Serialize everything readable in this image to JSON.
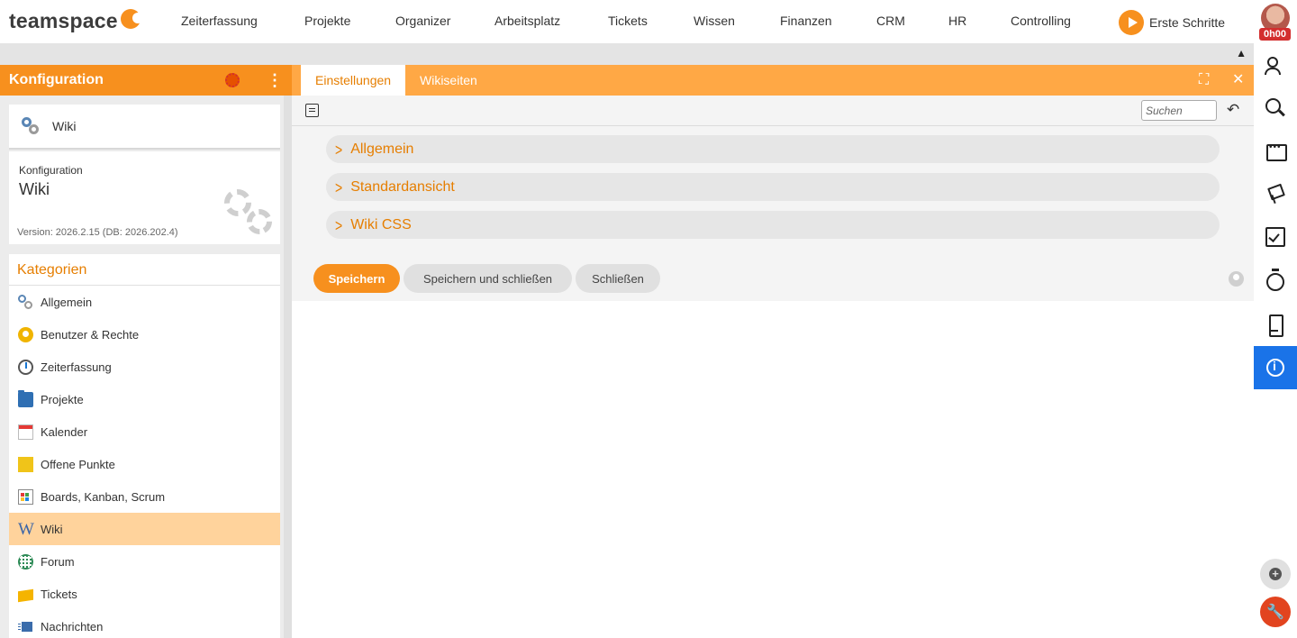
{
  "brand": {
    "name": "teamspace"
  },
  "nav": {
    "items": [
      "Zeiterfassung",
      "Projekte",
      "Organizer",
      "Arbeitsplatz",
      "Tickets",
      "Wissen",
      "Finanzen",
      "CRM",
      "HR",
      "Controlling"
    ],
    "erste_schritte": "Erste Schritte",
    "timer": "0h00"
  },
  "left": {
    "header_title": "Konfiguration",
    "module_card": {
      "label": "Wiki"
    },
    "info_card": {
      "small": "Konfiguration",
      "title": "Wiki",
      "version": "Version: 2026.2.15 (DB: 2026.202.4)"
    },
    "categories": {
      "title": "Kategorien",
      "items": [
        {
          "label": "Allgemein",
          "icon": "gears-icon"
        },
        {
          "label": "Benutzer & Rechte",
          "icon": "users-icon"
        },
        {
          "label": "Zeiterfassung",
          "icon": "stopwatch-icon"
        },
        {
          "label": "Projekte",
          "icon": "folder-icon"
        },
        {
          "label": "Kalender",
          "icon": "calendar-icon"
        },
        {
          "label": "Offene Punkte",
          "icon": "sticky-note-icon"
        },
        {
          "label": "Boards, Kanban, Scrum",
          "icon": "board-icon"
        },
        {
          "label": "Wiki",
          "icon": "wiki-icon",
          "active": true
        },
        {
          "label": "Forum",
          "icon": "globe-icon"
        },
        {
          "label": "Tickets",
          "icon": "ticket-icon"
        },
        {
          "label": "Nachrichten",
          "icon": "messages-icon"
        }
      ]
    }
  },
  "main": {
    "tabs": [
      {
        "label": "Einstellungen",
        "active": true
      },
      {
        "label": "Wikiseiten",
        "active": false
      }
    ],
    "search": {
      "placeholder": "Suchen",
      "value": ""
    },
    "sections": [
      {
        "label": "Allgemein"
      },
      {
        "label": "Standardansicht"
      },
      {
        "label": "Wiki CSS"
      }
    ],
    "buttons": {
      "save": "Speichern",
      "save_close": "Speichern und schließen",
      "close": "Schließen"
    }
  },
  "colors": {
    "accent": "#f7901e",
    "tab_bar": "#ffa845",
    "active_item": "#ffd39c",
    "info_active": "#1a73e8",
    "wrench": "#e2441f"
  }
}
